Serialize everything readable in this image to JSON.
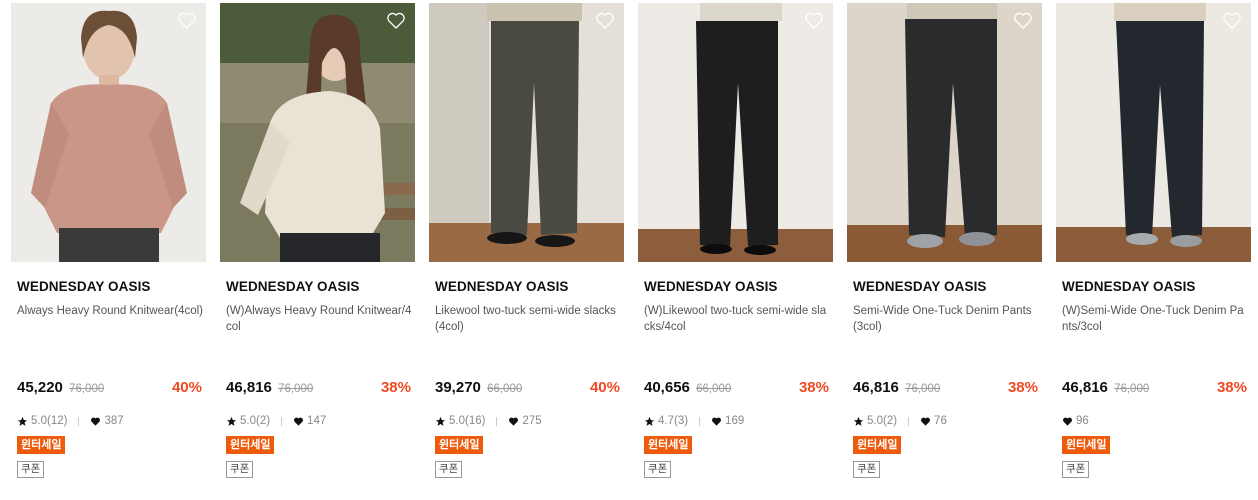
{
  "products": [
    {
      "brand": "WEDNESDAY OASIS",
      "name": "Always Heavy Round Knitwear(4col)",
      "price": "45,220",
      "original_price": "76,000",
      "discount": "40%",
      "rating": "5.0(12)",
      "likes": "387",
      "sale_badge": "윈터세일",
      "coupon_badge": "쿠폰",
      "image_icon": "pink-knitwear-model-photo"
    },
    {
      "brand": "WEDNESDAY OASIS",
      "name": "(W)Always Heavy Round Knitwear/4col",
      "price": "46,816",
      "original_price": "76,000",
      "discount": "38%",
      "rating": "5.0(2)",
      "likes": "147",
      "sale_badge": "윈터세일",
      "coupon_badge": "쿠폰",
      "image_icon": "ivory-knitwear-model-photo"
    },
    {
      "brand": "WEDNESDAY OASIS",
      "name": "Likewool two-tuck semi-wide slacks(4col)",
      "price": "39,270",
      "original_price": "66,000",
      "discount": "40%",
      "rating": "5.0(16)",
      "likes": "275",
      "sale_badge": "윈터세일",
      "coupon_badge": "쿠폰",
      "image_icon": "charcoal-slacks-photo"
    },
    {
      "brand": "WEDNESDAY OASIS",
      "name": "(W)Likewool two-tuck semi-wide slacks/4col",
      "price": "40,656",
      "original_price": "66,000",
      "discount": "38%",
      "rating": "4.7(3)",
      "likes": "169",
      "sale_badge": "윈터세일",
      "coupon_badge": "쿠폰",
      "image_icon": "black-slacks-photo"
    },
    {
      "brand": "WEDNESDAY OASIS",
      "name": "Semi-Wide One-Tuck Denim Pants(3col)",
      "price": "46,816",
      "original_price": "76,000",
      "discount": "38%",
      "rating": "5.0(2)",
      "likes": "76",
      "sale_badge": "윈터세일",
      "coupon_badge": "쿠폰",
      "image_icon": "black-denim-pants-photo"
    },
    {
      "brand": "WEDNESDAY OASIS",
      "name": "(W)Semi-Wide One-Tuck Denim Pants/3col",
      "price": "46,816",
      "original_price": "76,000",
      "discount": "38%",
      "rating": "",
      "likes": "96",
      "sale_badge": "윈터세일",
      "coupon_badge": "쿠폰",
      "image_icon": "navy-denim-pants-photo"
    }
  ],
  "colors": {
    "discount": "#ef4a23",
    "sale_badge_bg": "#ef5b0c",
    "brand_text": "#111111",
    "muted_text": "#888888"
  }
}
